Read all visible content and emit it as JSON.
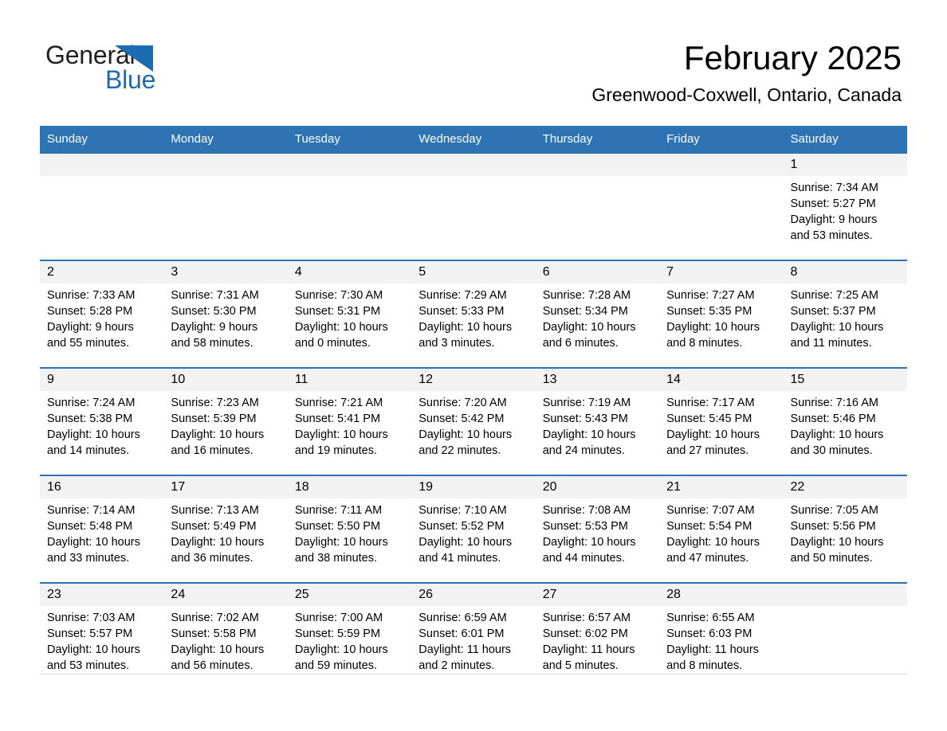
{
  "brand": {
    "name_part1": "General",
    "name_part2": "Blue",
    "accent_color": "#1b6cb0",
    "triangle_icon": "triangle-right-icon"
  },
  "header": {
    "month_title": "February 2025",
    "location": "Greenwood-Coxwell, Ontario, Canada",
    "header_bg_color": "#2e74b5",
    "daynum_bg_color": "#f2f2f2"
  },
  "weekdays": [
    "Sunday",
    "Monday",
    "Tuesday",
    "Wednesday",
    "Thursday",
    "Friday",
    "Saturday"
  ],
  "weeks": [
    [
      {
        "day": "",
        "empty": true
      },
      {
        "day": "",
        "empty": true
      },
      {
        "day": "",
        "empty": true
      },
      {
        "day": "",
        "empty": true
      },
      {
        "day": "",
        "empty": true
      },
      {
        "day": "",
        "empty": true
      },
      {
        "day": "1",
        "sunrise": "Sunrise: 7:34 AM",
        "sunset": "Sunset: 5:27 PM",
        "daylight_l1": "Daylight: 9 hours",
        "daylight_l2": "and 53 minutes."
      }
    ],
    [
      {
        "day": "2",
        "sunrise": "Sunrise: 7:33 AM",
        "sunset": "Sunset: 5:28 PM",
        "daylight_l1": "Daylight: 9 hours",
        "daylight_l2": "and 55 minutes."
      },
      {
        "day": "3",
        "sunrise": "Sunrise: 7:31 AM",
        "sunset": "Sunset: 5:30 PM",
        "daylight_l1": "Daylight: 9 hours",
        "daylight_l2": "and 58 minutes."
      },
      {
        "day": "4",
        "sunrise": "Sunrise: 7:30 AM",
        "sunset": "Sunset: 5:31 PM",
        "daylight_l1": "Daylight: 10 hours",
        "daylight_l2": "and 0 minutes."
      },
      {
        "day": "5",
        "sunrise": "Sunrise: 7:29 AM",
        "sunset": "Sunset: 5:33 PM",
        "daylight_l1": "Daylight: 10 hours",
        "daylight_l2": "and 3 minutes."
      },
      {
        "day": "6",
        "sunrise": "Sunrise: 7:28 AM",
        "sunset": "Sunset: 5:34 PM",
        "daylight_l1": "Daylight: 10 hours",
        "daylight_l2": "and 6 minutes."
      },
      {
        "day": "7",
        "sunrise": "Sunrise: 7:27 AM",
        "sunset": "Sunset: 5:35 PM",
        "daylight_l1": "Daylight: 10 hours",
        "daylight_l2": "and 8 minutes."
      },
      {
        "day": "8",
        "sunrise": "Sunrise: 7:25 AM",
        "sunset": "Sunset: 5:37 PM",
        "daylight_l1": "Daylight: 10 hours",
        "daylight_l2": "and 11 minutes."
      }
    ],
    [
      {
        "day": "9",
        "sunrise": "Sunrise: 7:24 AM",
        "sunset": "Sunset: 5:38 PM",
        "daylight_l1": "Daylight: 10 hours",
        "daylight_l2": "and 14 minutes."
      },
      {
        "day": "10",
        "sunrise": "Sunrise: 7:23 AM",
        "sunset": "Sunset: 5:39 PM",
        "daylight_l1": "Daylight: 10 hours",
        "daylight_l2": "and 16 minutes."
      },
      {
        "day": "11",
        "sunrise": "Sunrise: 7:21 AM",
        "sunset": "Sunset: 5:41 PM",
        "daylight_l1": "Daylight: 10 hours",
        "daylight_l2": "and 19 minutes."
      },
      {
        "day": "12",
        "sunrise": "Sunrise: 7:20 AM",
        "sunset": "Sunset: 5:42 PM",
        "daylight_l1": "Daylight: 10 hours",
        "daylight_l2": "and 22 minutes."
      },
      {
        "day": "13",
        "sunrise": "Sunrise: 7:19 AM",
        "sunset": "Sunset: 5:43 PM",
        "daylight_l1": "Daylight: 10 hours",
        "daylight_l2": "and 24 minutes."
      },
      {
        "day": "14",
        "sunrise": "Sunrise: 7:17 AM",
        "sunset": "Sunset: 5:45 PM",
        "daylight_l1": "Daylight: 10 hours",
        "daylight_l2": "and 27 minutes."
      },
      {
        "day": "15",
        "sunrise": "Sunrise: 7:16 AM",
        "sunset": "Sunset: 5:46 PM",
        "daylight_l1": "Daylight: 10 hours",
        "daylight_l2": "and 30 minutes."
      }
    ],
    [
      {
        "day": "16",
        "sunrise": "Sunrise: 7:14 AM",
        "sunset": "Sunset: 5:48 PM",
        "daylight_l1": "Daylight: 10 hours",
        "daylight_l2": "and 33 minutes."
      },
      {
        "day": "17",
        "sunrise": "Sunrise: 7:13 AM",
        "sunset": "Sunset: 5:49 PM",
        "daylight_l1": "Daylight: 10 hours",
        "daylight_l2": "and 36 minutes."
      },
      {
        "day": "18",
        "sunrise": "Sunrise: 7:11 AM",
        "sunset": "Sunset: 5:50 PM",
        "daylight_l1": "Daylight: 10 hours",
        "daylight_l2": "and 38 minutes."
      },
      {
        "day": "19",
        "sunrise": "Sunrise: 7:10 AM",
        "sunset": "Sunset: 5:52 PM",
        "daylight_l1": "Daylight: 10 hours",
        "daylight_l2": "and 41 minutes."
      },
      {
        "day": "20",
        "sunrise": "Sunrise: 7:08 AM",
        "sunset": "Sunset: 5:53 PM",
        "daylight_l1": "Daylight: 10 hours",
        "daylight_l2": "and 44 minutes."
      },
      {
        "day": "21",
        "sunrise": "Sunrise: 7:07 AM",
        "sunset": "Sunset: 5:54 PM",
        "daylight_l1": "Daylight: 10 hours",
        "daylight_l2": "and 47 minutes."
      },
      {
        "day": "22",
        "sunrise": "Sunrise: 7:05 AM",
        "sunset": "Sunset: 5:56 PM",
        "daylight_l1": "Daylight: 10 hours",
        "daylight_l2": "and 50 minutes."
      }
    ],
    [
      {
        "day": "23",
        "sunrise": "Sunrise: 7:03 AM",
        "sunset": "Sunset: 5:57 PM",
        "daylight_l1": "Daylight: 10 hours",
        "daylight_l2": "and 53 minutes."
      },
      {
        "day": "24",
        "sunrise": "Sunrise: 7:02 AM",
        "sunset": "Sunset: 5:58 PM",
        "daylight_l1": "Daylight: 10 hours",
        "daylight_l2": "and 56 minutes."
      },
      {
        "day": "25",
        "sunrise": "Sunrise: 7:00 AM",
        "sunset": "Sunset: 5:59 PM",
        "daylight_l1": "Daylight: 10 hours",
        "daylight_l2": "and 59 minutes."
      },
      {
        "day": "26",
        "sunrise": "Sunrise: 6:59 AM",
        "sunset": "Sunset: 6:01 PM",
        "daylight_l1": "Daylight: 11 hours",
        "daylight_l2": "and 2 minutes."
      },
      {
        "day": "27",
        "sunrise": "Sunrise: 6:57 AM",
        "sunset": "Sunset: 6:02 PM",
        "daylight_l1": "Daylight: 11 hours",
        "daylight_l2": "and 5 minutes."
      },
      {
        "day": "28",
        "sunrise": "Sunrise: 6:55 AM",
        "sunset": "Sunset: 6:03 PM",
        "daylight_l1": "Daylight: 11 hours",
        "daylight_l2": "and 8 minutes."
      },
      {
        "day": "",
        "empty": true
      }
    ]
  ]
}
